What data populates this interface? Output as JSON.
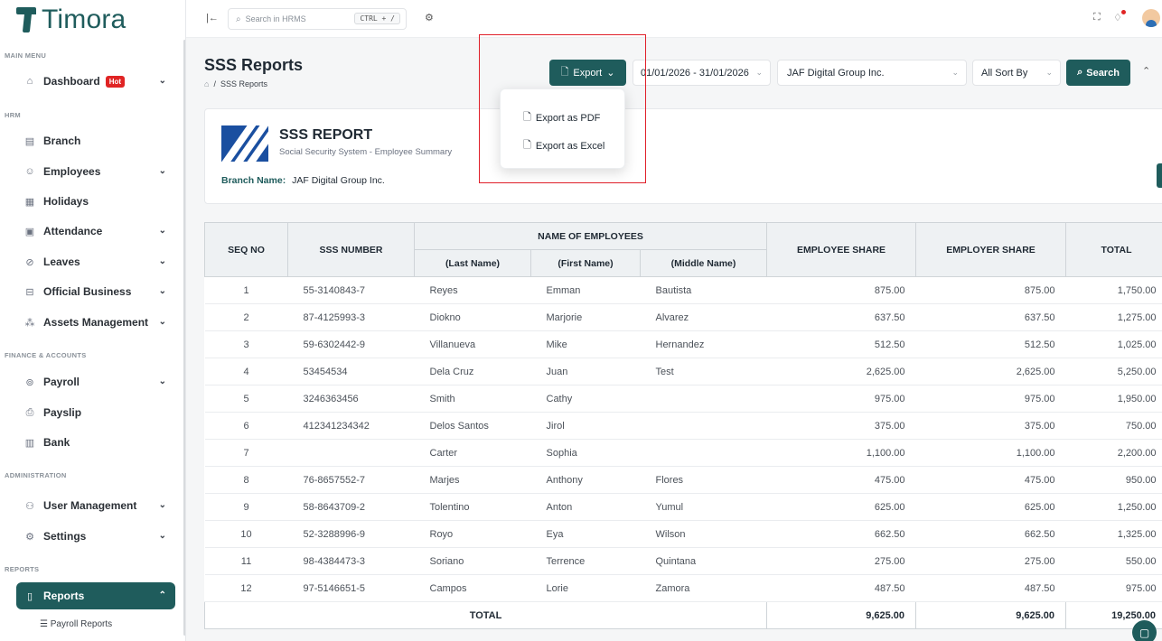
{
  "brand": {
    "name": "Timora"
  },
  "sidebar": {
    "sections": {
      "main": "MAIN MENU",
      "hrm": "HRM",
      "finance": "FINANCE & ACCOUNTS",
      "admin": "ADMINISTRATION",
      "reports": "REPORTS"
    },
    "items": {
      "dashboard": "Dashboard",
      "hot": "Hot",
      "branch": "Branch",
      "employees": "Employees",
      "holidays": "Holidays",
      "attendance": "Attendance",
      "leaves": "Leaves",
      "official_business": "Official Business",
      "assets": "Assets Management",
      "payroll": "Payroll",
      "payslip": "Payslip",
      "bank": "Bank",
      "user_mgmt": "User Management",
      "settings": "Settings",
      "reports": "Reports",
      "payroll_reports": "Payroll Reports"
    }
  },
  "topbar": {
    "search_placeholder": "Search in HRMS",
    "shortcut": "CTRL + /"
  },
  "page": {
    "title": "SSS Reports",
    "breadcrumb_current": "SSS Reports"
  },
  "toolbar": {
    "export_label": "Export",
    "date_range": "01/01/2026 - 31/01/2026",
    "branch_value": "JAF Digital Group Inc.",
    "sort_value": "All Sort By",
    "search_label": "Search"
  },
  "export_menu": {
    "pdf": "Export as PDF",
    "excel": "Export as Excel"
  },
  "report": {
    "title": "SSS REPORT",
    "subtitle": "Social Security System - Employee Summary",
    "branch_label": "Branch Name:",
    "branch_value": "JAF Digital Group Inc."
  },
  "table": {
    "headers": {
      "seq": "SEQ NO",
      "sss": "SSS NUMBER",
      "name_group": "NAME OF EMPLOYEES",
      "last": "(Last Name)",
      "first": "(First Name)",
      "middle": "(Middle Name)",
      "employee_share": "EMPLOYEE SHARE",
      "employer_share": "EMPLOYER SHARE",
      "total": "TOTAL"
    },
    "rows": [
      {
        "seq": "1",
        "sss": "55-3140843-7",
        "last": "Reyes",
        "first": "Emman",
        "middle": "Bautista",
        "ee": "875.00",
        "er": "875.00",
        "total": "1,750.00"
      },
      {
        "seq": "2",
        "sss": "87-4125993-3",
        "last": "Diokno",
        "first": "Marjorie",
        "middle": "Alvarez",
        "ee": "637.50",
        "er": "637.50",
        "total": "1,275.00"
      },
      {
        "seq": "3",
        "sss": "59-6302442-9",
        "last": "Villanueva",
        "first": "Mike",
        "middle": "Hernandez",
        "ee": "512.50",
        "er": "512.50",
        "total": "1,025.00"
      },
      {
        "seq": "4",
        "sss": "53454534",
        "last": "Dela Cruz",
        "first": "Juan",
        "middle": "Test",
        "ee": "2,625.00",
        "er": "2,625.00",
        "total": "5,250.00"
      },
      {
        "seq": "5",
        "sss": "3246363456",
        "last": "Smith",
        "first": "Cathy",
        "middle": "",
        "ee": "975.00",
        "er": "975.00",
        "total": "1,950.00"
      },
      {
        "seq": "6",
        "sss": "412341234342",
        "last": "Delos Santos",
        "first": "Jirol",
        "middle": "",
        "ee": "375.00",
        "er": "375.00",
        "total": "750.00"
      },
      {
        "seq": "7",
        "sss": "",
        "last": "Carter",
        "first": "Sophia",
        "middle": "",
        "ee": "1,100.00",
        "er": "1,100.00",
        "total": "2,200.00"
      },
      {
        "seq": "8",
        "sss": "76-8657552-7",
        "last": "Marjes",
        "first": "Anthony",
        "middle": "Flores",
        "ee": "475.00",
        "er": "475.00",
        "total": "950.00"
      },
      {
        "seq": "9",
        "sss": "58-8643709-2",
        "last": "Tolentino",
        "first": "Anton",
        "middle": "Yumul",
        "ee": "625.00",
        "er": "625.00",
        "total": "1,250.00"
      },
      {
        "seq": "10",
        "sss": "52-3288996-9",
        "last": "Royo",
        "first": "Eya",
        "middle": "Wilson",
        "ee": "662.50",
        "er": "662.50",
        "total": "1,325.00"
      },
      {
        "seq": "11",
        "sss": "98-4384473-3",
        "last": "Soriano",
        "first": "Terrence",
        "middle": "Quintana",
        "ee": "275.00",
        "er": "275.00",
        "total": "550.00"
      },
      {
        "seq": "12",
        "sss": "97-5146651-5",
        "last": "Campos",
        "first": "Lorie",
        "middle": "Zamora",
        "ee": "487.50",
        "er": "487.50",
        "total": "975.00"
      }
    ],
    "totals": {
      "label": "TOTAL",
      "ee": "9,625.00",
      "er": "9,625.00",
      "total": "19,250.00"
    }
  },
  "colors": {
    "primary": "#1f5c5c",
    "hot_badge": "#e02424",
    "annotation_box": "#e0202a"
  }
}
